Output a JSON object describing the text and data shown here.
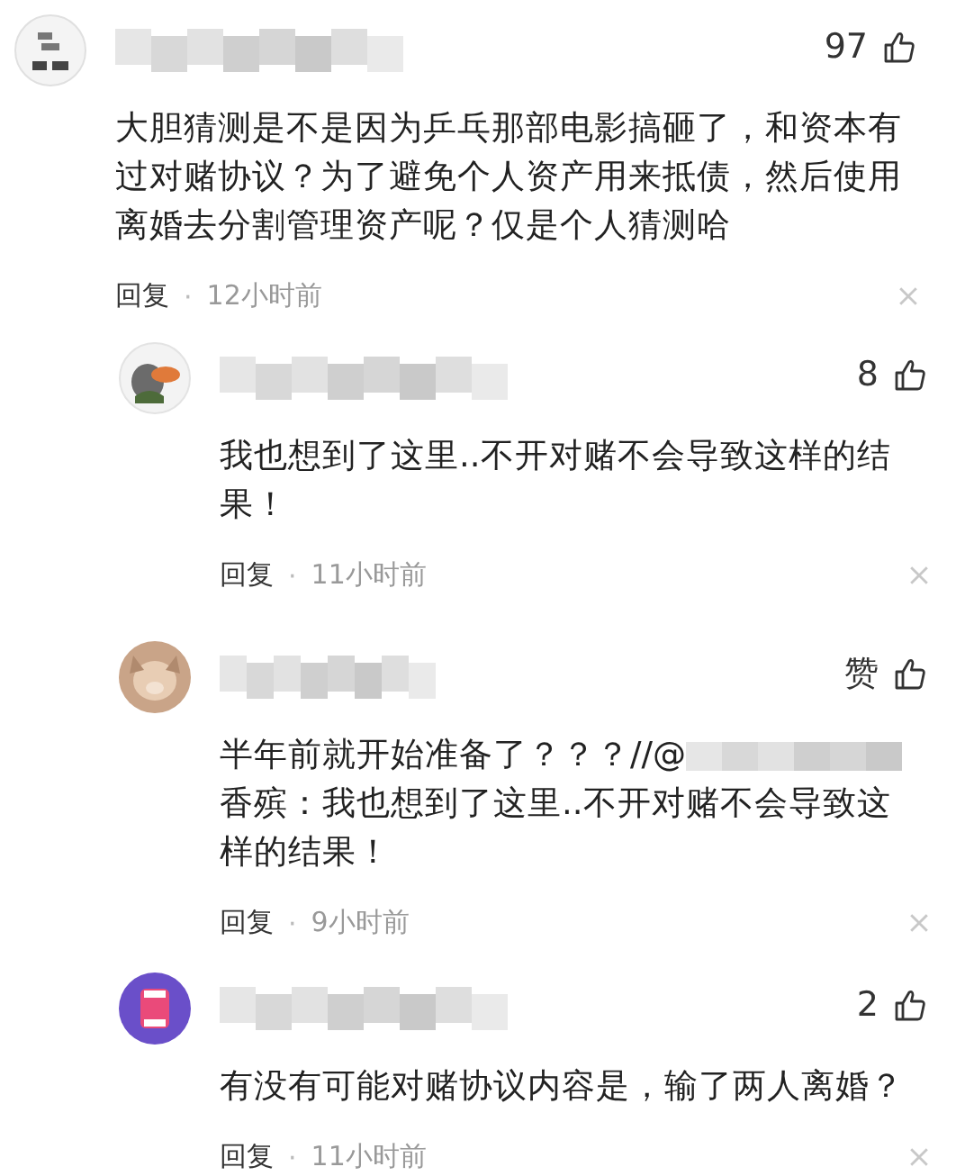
{
  "comment": {
    "avatar": {
      "kind": "logo"
    },
    "likes": "97",
    "text_parts": [
      "大胆猜测是不是因为乒乓那部电影搞砸了，和资本有过对赌协议？为了避免个人资产用来抵债，然后使用离婚去分割管理资产呢？仅是个人猜测哈"
    ],
    "reply_label": "回复",
    "separator": "·",
    "time": "12小时前",
    "replies": [
      {
        "avatar": {
          "kind": "duck"
        },
        "likes": "8",
        "text_parts": [
          "我也想到了这里..不开对赌不会导致这样的结果！"
        ],
        "reply_label": "回复",
        "separator": "·",
        "time": "11小时前"
      },
      {
        "avatar": {
          "kind": "cat"
        },
        "likes": "赞",
        "text_parts": [
          "半年前就开始准备了？？？//@",
          "香殡：我也想到了这里..不开对赌不会导致这样的结果！"
        ],
        "reply_label": "回复",
        "separator": "·",
        "time": "9小时前"
      },
      {
        "avatar": {
          "kind": "pink"
        },
        "likes": "2",
        "text_parts": [
          "有没有可能对赌协议内容是，输了两人离婚？"
        ],
        "reply_label": "回复",
        "separator": "·",
        "time": "11小时前"
      }
    ]
  }
}
